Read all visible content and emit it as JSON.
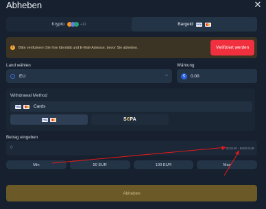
{
  "header": {
    "title": "Abheben",
    "close_icon": "close-icon"
  },
  "tabs": [
    {
      "label": "Krypto",
      "badge": "+12",
      "active": false
    },
    {
      "label": "Bargeld",
      "active": true
    }
  ],
  "alert": {
    "icon": "exclamation-icon",
    "message": "Bitte verifizieren Sie Ihre Identität und E-Mail-Adresse, bevor Sie abheben.",
    "button_label": "Verifiziert werden"
  },
  "country": {
    "label": "Land wählen",
    "value": "EU"
  },
  "currency": {
    "label": "Währung",
    "symbol": "€",
    "value": "0.00"
  },
  "withdrawal": {
    "title": "Withdrawal Method",
    "selected": "Cards",
    "options": [
      {
        "name": "cards"
      },
      {
        "name": "sepa",
        "label_prefix": "S",
        "label_accent": "€",
        "label_suffix": "PA"
      }
    ]
  },
  "amount": {
    "label": "Betrag eingeben",
    "placeholder": "0",
    "range": "30 EUR - 5000 EUR"
  },
  "quick_amounts": [
    "Min",
    "50 EUR",
    "100 EUR",
    "Max"
  ],
  "submit_label": "Abheben",
  "colors": {
    "background": "#16202e",
    "alert_button": "#f0303f",
    "submit": "#6b5a27",
    "annotation_arrow": "#e01b1b"
  }
}
